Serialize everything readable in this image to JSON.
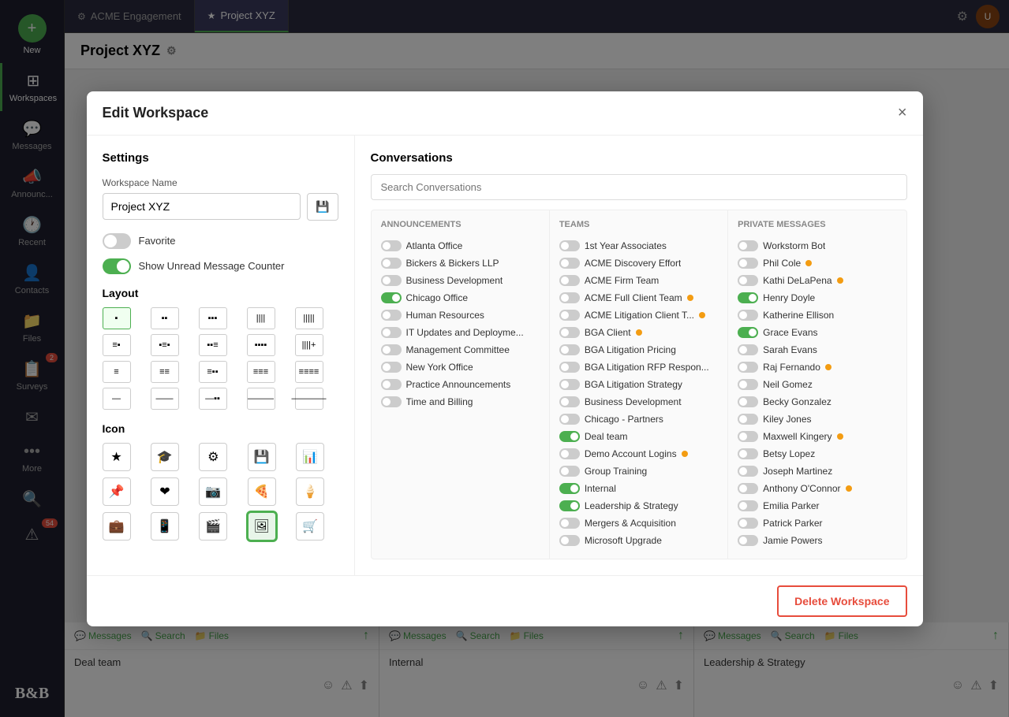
{
  "sidebar": {
    "items": [
      {
        "id": "new",
        "label": "New",
        "icon": "+"
      },
      {
        "id": "workspaces",
        "label": "Workspaces",
        "icon": "⊞"
      },
      {
        "id": "messages",
        "label": "Messages",
        "icon": "💬"
      },
      {
        "id": "announce",
        "label": "Announc...",
        "icon": "📣"
      },
      {
        "id": "recent",
        "label": "Recent",
        "icon": "🕐"
      },
      {
        "id": "contacts",
        "label": "Contacts",
        "icon": "👤"
      },
      {
        "id": "files",
        "label": "Files",
        "icon": "📁"
      },
      {
        "id": "surveys",
        "label": "Surveys",
        "icon": "📋",
        "badge": "2"
      },
      {
        "id": "email",
        "label": "",
        "icon": "✉"
      },
      {
        "id": "more",
        "label": "More",
        "icon": "•••"
      },
      {
        "id": "search",
        "label": "",
        "icon": "🔍"
      },
      {
        "id": "alert",
        "label": "",
        "icon": "⚠",
        "badge": "54"
      }
    ],
    "logo": "B&B"
  },
  "topbar": {
    "tabs": [
      {
        "id": "acme-engagement",
        "label": "ACME Engagement",
        "active": false,
        "icon": "⚙"
      },
      {
        "id": "project-xyz",
        "label": "Project XYZ",
        "active": true,
        "icon": "★"
      }
    ],
    "title": "Project XYZ"
  },
  "modal": {
    "title": "Edit Workspace",
    "close_label": "×",
    "settings": {
      "title": "Settings",
      "workspace_name_label": "Workspace Name",
      "workspace_name_value": "Project XYZ",
      "save_icon": "💾",
      "favorite_label": "Favorite",
      "favorite_on": false,
      "show_unread_label": "Show Unread Message Counter",
      "show_unread_on": true,
      "layout_title": "Layout",
      "icon_title": "Icon",
      "icons": [
        "★",
        "🎓",
        "⚙",
        "💾",
        "📊",
        "📌",
        "❤",
        "📷",
        "🍕",
        "🍦",
        "💼",
        "📱",
        "🎬",
        "🖼",
        "🛒"
      ]
    },
    "conversations": {
      "title": "Conversations",
      "search_placeholder": "Search Conversations",
      "columns": {
        "announcements": {
          "title": "Announcements",
          "items": [
            {
              "name": "Atlanta Office",
              "on": false
            },
            {
              "name": "Bickers & Bickers LLP",
              "on": false
            },
            {
              "name": "Business Development",
              "on": false
            },
            {
              "name": "Chicago Office",
              "on": true
            },
            {
              "name": "Human Resources",
              "on": false
            },
            {
              "name": "IT Updates and Deployme...",
              "on": false
            },
            {
              "name": "Management Committee",
              "on": false
            },
            {
              "name": "New York Office",
              "on": false
            },
            {
              "name": "Practice Announcements",
              "on": false
            },
            {
              "name": "Time and Billing",
              "on": false
            }
          ]
        },
        "teams": {
          "title": "Teams",
          "items": [
            {
              "name": "1st Year Associates",
              "on": false
            },
            {
              "name": "ACME Discovery Effort",
              "on": false
            },
            {
              "name": "ACME Firm Team",
              "on": false
            },
            {
              "name": "ACME Full Client Team",
              "on": false,
              "badge": true
            },
            {
              "name": "ACME Litigation Client T...",
              "on": false,
              "badge": true
            },
            {
              "name": "BGA Client",
              "on": false,
              "badge": true
            },
            {
              "name": "BGA Litigation Pricing",
              "on": false
            },
            {
              "name": "BGA Litigation RFP Respon...",
              "on": false
            },
            {
              "name": "BGA Litigation Strategy",
              "on": false
            },
            {
              "name": "Business Development",
              "on": false
            },
            {
              "name": "Chicago - Partners",
              "on": false
            },
            {
              "name": "Deal team",
              "on": true
            },
            {
              "name": "Demo Account Logins",
              "on": false,
              "badge": true
            },
            {
              "name": "Group Training",
              "on": false
            },
            {
              "name": "Internal",
              "on": true
            },
            {
              "name": "Leadership & Strategy",
              "on": true
            },
            {
              "name": "Mergers & Acquisition",
              "on": false
            },
            {
              "name": "Microsoft Upgrade",
              "on": false
            }
          ]
        },
        "private": {
          "title": "Private Messages",
          "items": [
            {
              "name": "Workstorm Bot",
              "on": false
            },
            {
              "name": "Phil Cole",
              "on": false,
              "badge": true
            },
            {
              "name": "Kathi DeLaPena",
              "on": false,
              "badge": true
            },
            {
              "name": "Henry Doyle",
              "on": true
            },
            {
              "name": "Katherine Ellison",
              "on": false
            },
            {
              "name": "Grace Evans",
              "on": true
            },
            {
              "name": "Sarah Evans",
              "on": false
            },
            {
              "name": "Raj Fernando",
              "on": false,
              "badge": true
            },
            {
              "name": "Neil Gomez",
              "on": false
            },
            {
              "name": "Becky Gonzalez",
              "on": false
            },
            {
              "name": "Kiley Jones",
              "on": false
            },
            {
              "name": "Maxwell Kingery",
              "on": false,
              "badge": true
            },
            {
              "name": "Betsy Lopez",
              "on": false
            },
            {
              "name": "Joseph Martinez",
              "on": false
            },
            {
              "name": "Anthony O'Connor",
              "on": false,
              "badge": true
            },
            {
              "name": "Emilia Parker",
              "on": false
            },
            {
              "name": "Patrick Parker",
              "on": false
            },
            {
              "name": "Jamie Powers",
              "on": false
            }
          ]
        }
      }
    },
    "delete_label": "Delete Workspace"
  },
  "panels": [
    {
      "id": "deal-team",
      "channel": "Deal team",
      "messages_label": "Messages",
      "search_label": "Search",
      "files_label": "Files"
    },
    {
      "id": "internal",
      "channel": "Internal",
      "messages_label": "Messages",
      "search_label": "Search",
      "files_label": "Files"
    },
    {
      "id": "leadership",
      "channel": "Leadership & Strategy",
      "messages_label": "Messages",
      "search_label": "Search",
      "files_label": "Files"
    }
  ]
}
